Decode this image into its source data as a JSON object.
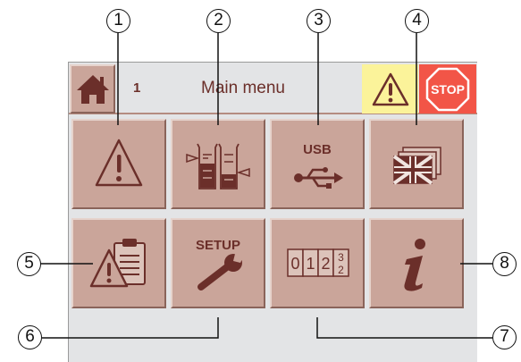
{
  "header": {
    "menu_number": "1",
    "title": "Main menu",
    "stop_label": "STOP"
  },
  "tiles": {
    "usb_label": "USB",
    "setup_label": "SETUP",
    "counter_digits": [
      "0",
      "1",
      "2"
    ],
    "counter_rolling_top": "3",
    "counter_rolling_bottom": "2"
  },
  "callouts": [
    "1",
    "2",
    "3",
    "4",
    "5",
    "6",
    "7",
    "8"
  ],
  "colors": {
    "tile": "#caa59a",
    "icon": "#6b2f2a",
    "screen_bg": "#e3e4e6",
    "warning_bg": "#fbf39a",
    "stop_bg": "#f25547"
  },
  "icons": {
    "home": "home-icon",
    "warning": "warning-icon",
    "stop": "stop-sign-icon",
    "tile_1": "warning-icon",
    "tile_2": "beakers-icon",
    "tile_3": "usb-icon",
    "tile_4": "language-flag-icon",
    "tile_5": "clipboard-warning-icon",
    "tile_6": "wrench-icon",
    "tile_7": "counter-icon",
    "tile_8": "info-icon"
  }
}
